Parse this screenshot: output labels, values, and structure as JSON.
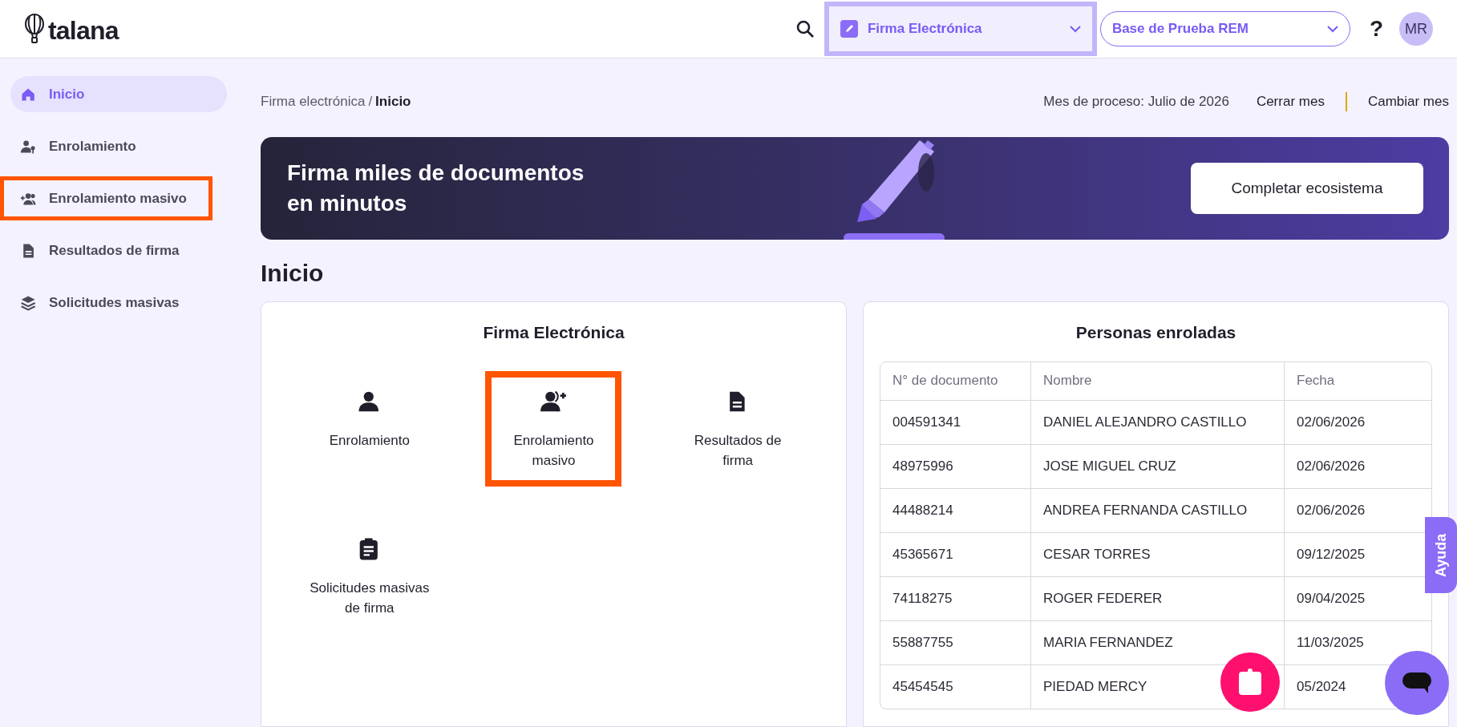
{
  "header": {
    "logo": "talana",
    "module_select": {
      "value": "Firma Electrónica",
      "focused": true
    },
    "company_select": {
      "value": "Base de Prueba REM",
      "focused": false
    },
    "help": "?",
    "avatar": "MR"
  },
  "sidebar": {
    "items": [
      {
        "label": "Inicio",
        "kind": "home",
        "selected": true,
        "highlighted": false
      },
      {
        "label": "Enrolamiento",
        "kind": "user-key",
        "selected": false,
        "highlighted": false
      },
      {
        "label": "Enrolamiento masivo",
        "kind": "users-plus",
        "selected": false,
        "highlighted": true
      },
      {
        "label": "Resultados de firma",
        "kind": "document",
        "selected": false,
        "highlighted": false
      },
      {
        "label": "Solicitudes masivas",
        "kind": "layers",
        "selected": false,
        "highlighted": false
      }
    ]
  },
  "breadcrumb": {
    "items": [
      "Firma electrónica",
      "Inicio"
    ],
    "separator": "/"
  },
  "process": {
    "month": "Mes de proceso: Julio de 2026",
    "actions": [
      "Cerrar mes",
      "Cambiar mes"
    ]
  },
  "banner": {
    "title": "Firma miles de documentos en minutos",
    "button": "Completar ecosistema"
  },
  "page_title": "Inicio",
  "shortcuts": {
    "title": "Firma Electrónica",
    "items": [
      {
        "label": "Enrolamiento",
        "kind": "user",
        "highlighted": false
      },
      {
        "label": "Enrolamiento masivo",
        "kind": "user-plus",
        "highlighted": true
      },
      {
        "label": "Resultados de firma",
        "kind": "document",
        "highlighted": false
      },
      {
        "label": "Solicitudes masivas de firma",
        "kind": "clipboard",
        "highlighted": false
      }
    ]
  },
  "enrolled": {
    "title": "Personas enroladas",
    "columns": [
      "N° de documento",
      "Nombre",
      "Fecha"
    ],
    "rows": [
      [
        "004591341",
        "DANIEL ALEJANDRO CASTILLO",
        "02/06/2026"
      ],
      [
        "48975996",
        "JOSE MIGUEL CRUZ",
        "02/06/2026"
      ],
      [
        "44488214",
        "ANDREA FERNANDA CASTILLO",
        "02/06/2026"
      ],
      [
        "45365671",
        "CESAR TORRES",
        "09/12/2025"
      ],
      [
        "74118275",
        "ROGER FEDERER",
        "09/04/2025"
      ],
      [
        "55887755",
        "MARIA FERNANDEZ",
        "11/03/2025"
      ],
      [
        "45454545",
        "PIEDAD MERCY",
        "05/2024"
      ]
    ]
  },
  "help_tab": "Ayuda"
}
